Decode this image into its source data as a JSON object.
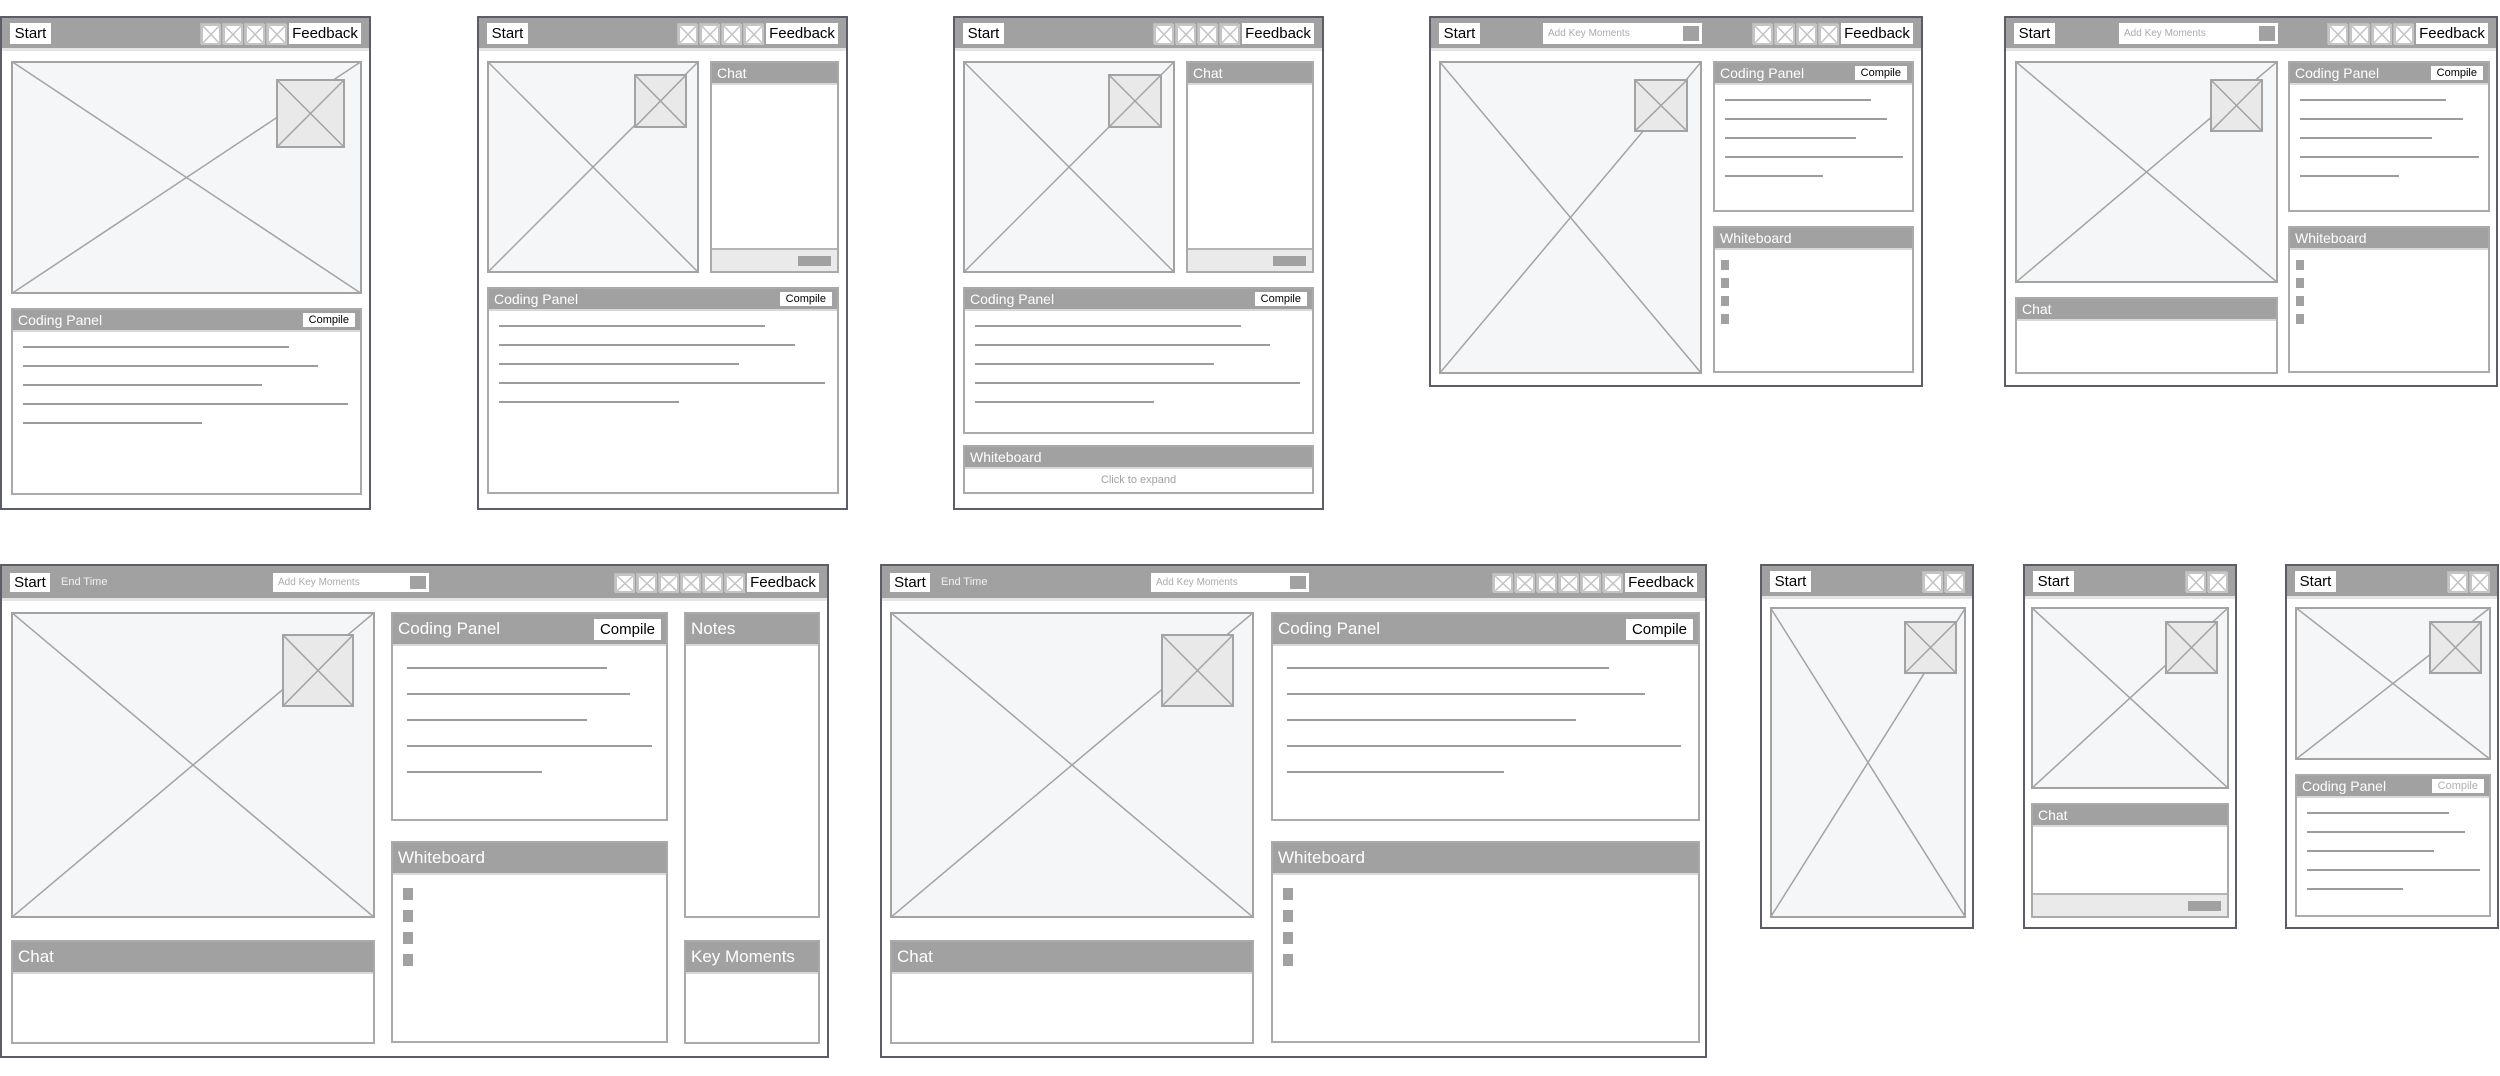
{
  "colors": {
    "header": "#a0a1a0",
    "frame_border": "#5b5e69",
    "panel_border": "#a9aaa9",
    "video_fill": "#f5f6f7",
    "pip_fill": "#e8e9e8"
  },
  "frames": [
    {
      "header": {
        "start": "Start",
        "icons": [
          "placeholder-icon",
          "placeholder-icon",
          "placeholder-icon",
          "placeholder-icon"
        ],
        "feedback": "Feedback"
      },
      "panels": [
        {
          "title": "Coding Panel",
          "button": "Compile"
        }
      ]
    },
    {
      "header": {
        "start": "Start",
        "icons": [
          "placeholder-icon",
          "placeholder-icon",
          "placeholder-icon",
          "placeholder-icon"
        ],
        "feedback": "Feedback"
      },
      "panels": [
        {
          "title": "Chat"
        },
        {
          "title": "Coding Panel",
          "button": "Compile"
        }
      ]
    },
    {
      "header": {
        "start": "Start",
        "icons": [
          "placeholder-icon",
          "placeholder-icon",
          "placeholder-icon",
          "placeholder-icon"
        ],
        "feedback": "Feedback"
      },
      "panels": [
        {
          "title": "Chat"
        },
        {
          "title": "Coding Panel",
          "button": "Compile"
        },
        {
          "title": "Whiteboard",
          "hint": "Click to expand"
        }
      ]
    },
    {
      "header": {
        "start": "Start",
        "key_moments_placeholder": "Add Key Moments",
        "icons": [
          "placeholder-icon",
          "placeholder-icon",
          "placeholder-icon",
          "placeholder-icon"
        ],
        "feedback": "Feedback"
      },
      "panels": [
        {
          "title": "Coding Panel",
          "button": "Compile"
        },
        {
          "title": "Whiteboard"
        }
      ]
    },
    {
      "header": {
        "start": "Start",
        "key_moments_placeholder": "Add Key Moments",
        "icons": [
          "placeholder-icon",
          "placeholder-icon",
          "placeholder-icon",
          "placeholder-icon"
        ],
        "feedback": "Feedback"
      },
      "panels": [
        {
          "title": "Coding Panel",
          "button": "Compile"
        },
        {
          "title": "Whiteboard"
        },
        {
          "title": "Chat"
        }
      ]
    },
    {
      "header": {
        "start": "Start",
        "end_time": "End Time",
        "key_moments_placeholder": "Add Key Moments",
        "icons": [
          "placeholder-icon",
          "placeholder-icon",
          "placeholder-icon",
          "placeholder-icon",
          "placeholder-icon",
          "placeholder-icon"
        ],
        "feedback": "Feedback"
      },
      "panels": [
        {
          "title": "Coding Panel",
          "button": "Compile"
        },
        {
          "title": "Whiteboard"
        },
        {
          "title": "Notes"
        },
        {
          "title": "Chat"
        },
        {
          "title": "Key Moments"
        }
      ]
    },
    {
      "header": {
        "start": "Start",
        "end_time": "End Time",
        "key_moments_placeholder": "Add Key Moments",
        "icons": [
          "placeholder-icon",
          "placeholder-icon",
          "placeholder-icon",
          "placeholder-icon",
          "placeholder-icon",
          "placeholder-icon"
        ],
        "feedback": "Feedback"
      },
      "panels": [
        {
          "title": "Coding Panel",
          "button": "Compile"
        },
        {
          "title": "Whiteboard"
        },
        {
          "title": "Chat"
        }
      ]
    },
    {
      "header": {
        "start": "Start",
        "icons": [
          "placeholder-icon",
          "placeholder-icon"
        ]
      },
      "panels": []
    },
    {
      "header": {
        "start": "Start",
        "icons": [
          "placeholder-icon",
          "placeholder-icon"
        ]
      },
      "panels": [
        {
          "title": "Chat"
        }
      ]
    },
    {
      "header": {
        "start": "Start",
        "icons": [
          "placeholder-icon",
          "placeholder-icon"
        ]
      },
      "panels": [
        {
          "title": "Coding Panel",
          "button": "Compile",
          "button_state": "disabled"
        }
      ]
    }
  ]
}
